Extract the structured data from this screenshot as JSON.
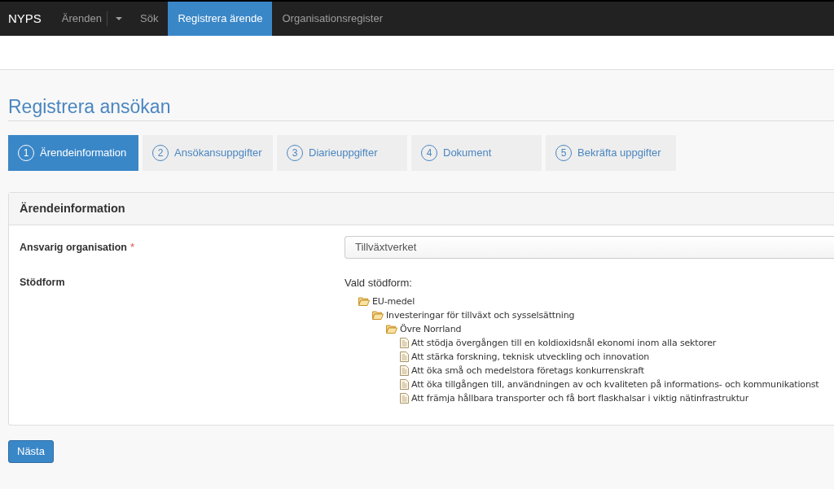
{
  "navbar": {
    "brand": "NYPS",
    "items": [
      {
        "label": "Ärenden",
        "kind": "split-dropdown",
        "selected": false
      },
      {
        "label": "Sök",
        "kind": "link",
        "selected": false
      },
      {
        "label": "Registrera ärende",
        "kind": "link",
        "selected": true
      },
      {
        "label": "Organisationsregister",
        "kind": "link",
        "selected": false
      }
    ]
  },
  "page_title": "Registrera ansökan",
  "steps": [
    {
      "number": "1",
      "label": "Ärendeinformation",
      "selected": true
    },
    {
      "number": "2",
      "label": "Ansökansuppgifter",
      "selected": false
    },
    {
      "number": "3",
      "label": "Diarieuppgifter",
      "selected": false
    },
    {
      "number": "4",
      "label": "Dokument",
      "selected": false
    },
    {
      "number": "5",
      "label": "Bekräfta uppgifter",
      "selected": false
    }
  ],
  "panel": {
    "title": "Ärendeinformation",
    "fields": [
      {
        "kind": "select",
        "label": "Ansvarig organisation",
        "required_mark": "*",
        "value": "Tillväxtverket"
      },
      {
        "kind": "tree",
        "label": "Stödform",
        "caption": "Vald stödform:",
        "tree": [
          {
            "kind": "folder",
            "label": "EU-medel",
            "expanded": true,
            "children": [
              {
                "kind": "folder",
                "label": "Investeringar för tillväxt och sysselsättning",
                "expanded": true,
                "children": [
                  {
                    "kind": "folder",
                    "label": "Övre Norrland",
                    "expanded": true,
                    "children": [
                      {
                        "kind": "document",
                        "label": "Att stödja övergången till en koldioxidsnål ekonomi inom alla sektorer"
                      },
                      {
                        "kind": "document",
                        "label": "Att stärka forskning, teknisk utveckling och innovation"
                      },
                      {
                        "kind": "document",
                        "label": "Att öka små och medelstora företags konkurrenskraft"
                      },
                      {
                        "kind": "document",
                        "label": "Att öka tillgången till, användningen av och kvaliteten på informations- och kommunikationst"
                      },
                      {
                        "kind": "document",
                        "label": "Att främja hållbara transporter och få bort flaskhalsar i viktig nätinfrastruktur"
                      }
                    ]
                  }
                ]
              }
            ]
          }
        ]
      }
    ]
  },
  "buttons": [
    {
      "label": "Nästa"
    }
  ]
}
